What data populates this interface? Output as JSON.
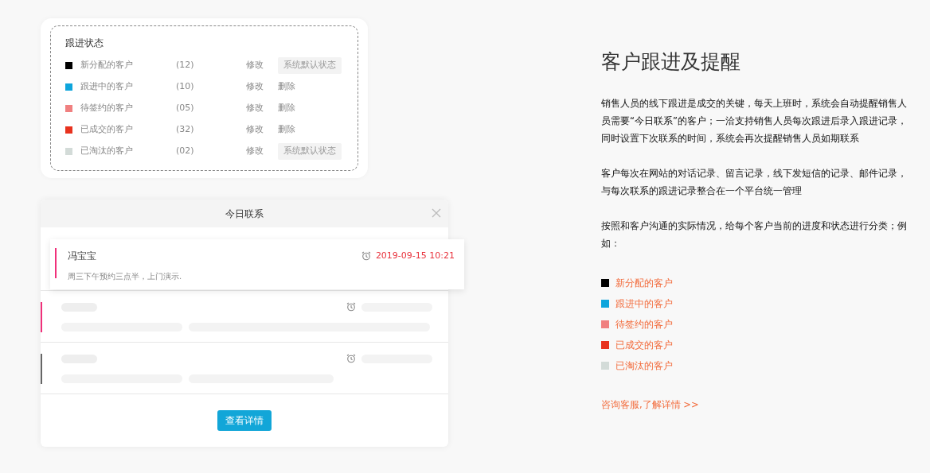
{
  "status_panel": {
    "title": "跟进状态",
    "statuses": [
      {
        "kind": "default",
        "color": "#000000",
        "name": "新分配的客户",
        "count": "(12)",
        "edit": "修改",
        "action": "系统默认状态"
      },
      {
        "kind": "deletable",
        "color": "#0ea5dc",
        "name": "跟进中的客户",
        "count": "(10)",
        "edit": "修改",
        "action": "删除"
      },
      {
        "kind": "deletable",
        "color": "#f08080",
        "name": "待签约的客户",
        "count": "(05)",
        "edit": "修改",
        "action": "删除"
      },
      {
        "kind": "deletable",
        "color": "#e8321e",
        "name": "已成交的客户",
        "count": "(32)",
        "edit": "修改",
        "action": "删除"
      },
      {
        "kind": "default",
        "color": "#d3dbd8",
        "name": "已淘汰的客户",
        "count": "(02)",
        "edit": "修改",
        "action": "系统默认状态"
      }
    ]
  },
  "dialog": {
    "title": "今日联系",
    "button": "查看详情",
    "entries": [
      {
        "kind": "card",
        "color": "#f0307a",
        "name": "冯宝宝",
        "time": "2019-09-15 10:21",
        "note": "周三下午预约三点半，上门演示."
      },
      {
        "kind": "skeleton",
        "color": "#f0307a",
        "long": true
      },
      {
        "kind": "skeleton",
        "color": "#666666",
        "long": false
      }
    ]
  },
  "intro": {
    "title": "客户跟进及提醒",
    "paragraphs": [
      "销售人员的线下跟进是成交的关键，每天上班时，系统会自动提醒销售人员需要“今日联系”的客户；一洽支持销售人员每次跟进后录入跟进记录，同时设置下次联系的时间，系统会再次提醒销售人员如期联系",
      "客户每次在网站的对话记录、留言记录，线下发短信的记录、邮件记录，与每次联系的跟进记录整合在一个平台统一管理",
      "按照和客户沟通的实际情况，给每个客户当前的进度和状态进行分类；例如："
    ],
    "legend": [
      {
        "color": "#000000",
        "label": "新分配的客户"
      },
      {
        "color": "#0ea5dc",
        "label": "跟进中的客户"
      },
      {
        "color": "#f08080",
        "label": "待签约的客户"
      },
      {
        "color": "#e8321e",
        "label": "已成交的客户"
      },
      {
        "color": "#d3dbd8",
        "label": "已淘汰的客户"
      }
    ],
    "link": "咨询客服,了解详情 >>"
  }
}
